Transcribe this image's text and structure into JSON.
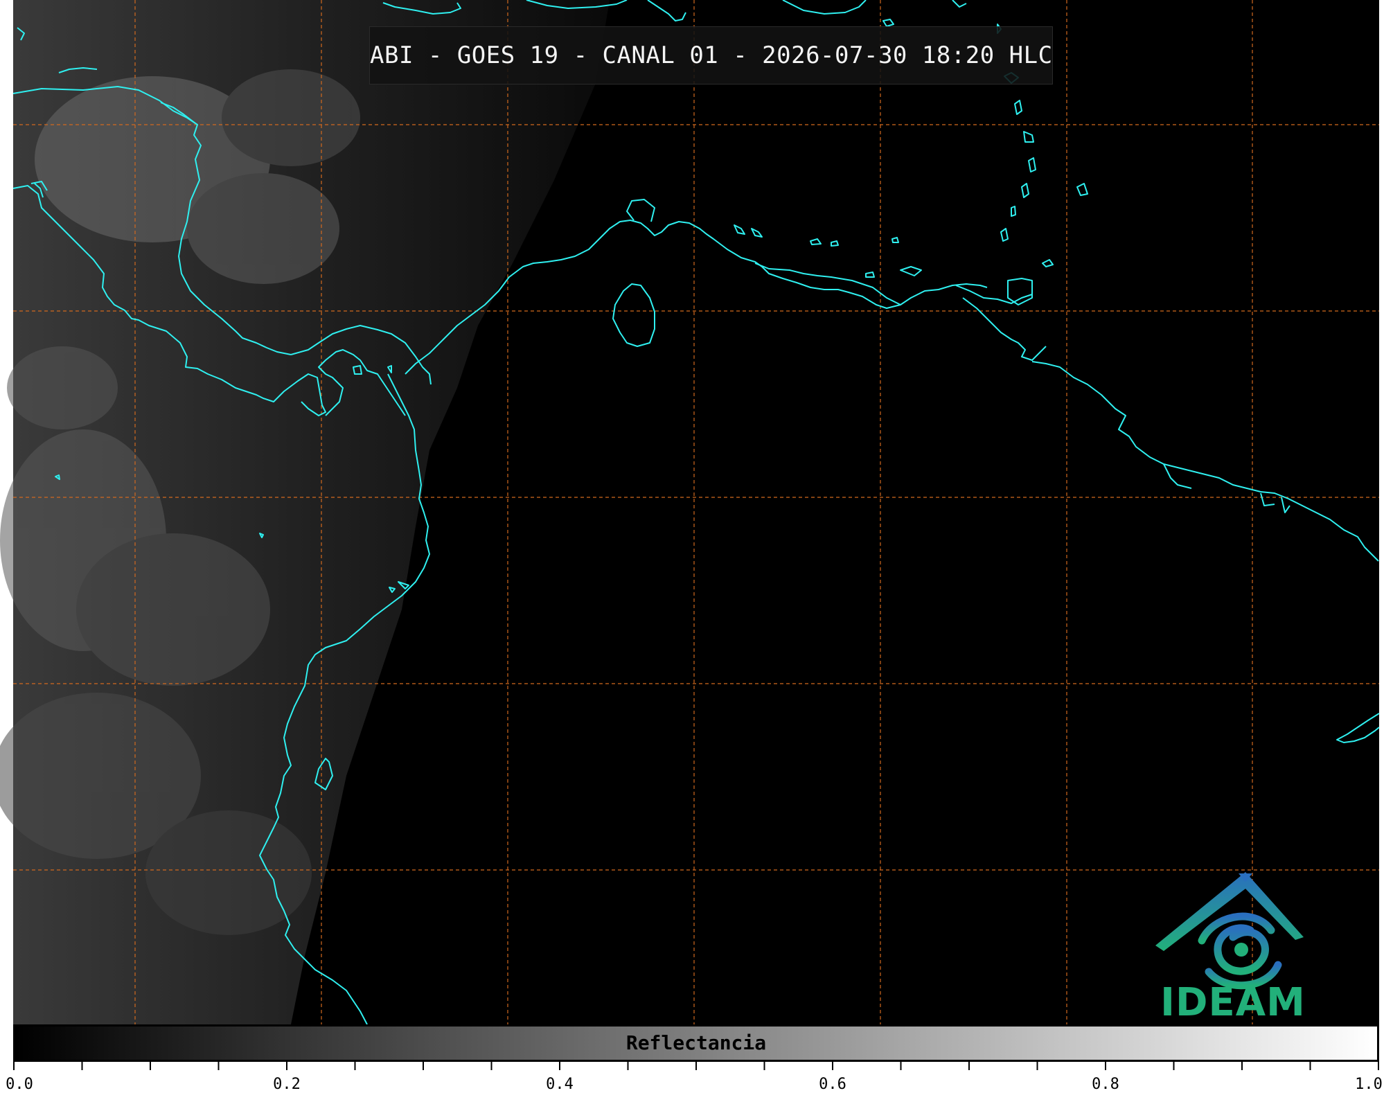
{
  "title": "ABI - GOES 19 - CANAL 01 - 2026-07-30 18:20 HLC",
  "logo": {
    "text": "IDEAM",
    "icon": "ideam-logo-icon",
    "color": "#22b07a"
  },
  "colorbar": {
    "label": "Reflectancia",
    "ticks": [
      {
        "value": 0.0,
        "label": "0.0"
      },
      {
        "value": 0.2,
        "label": "0.2"
      },
      {
        "value": 0.4,
        "label": "0.4"
      },
      {
        "value": 0.6,
        "label": "0.6"
      },
      {
        "value": 0.8,
        "label": "0.8"
      },
      {
        "value": 1.0,
        "label": "1.0"
      }
    ],
    "minor_step": 0.05,
    "colormap": [
      "#000000",
      "#ffffff"
    ]
  },
  "map": {
    "coastline_color": "#2ff0f0",
    "grid_color": "#d2691e",
    "grid_style": "dashed",
    "background": "#000000"
  }
}
